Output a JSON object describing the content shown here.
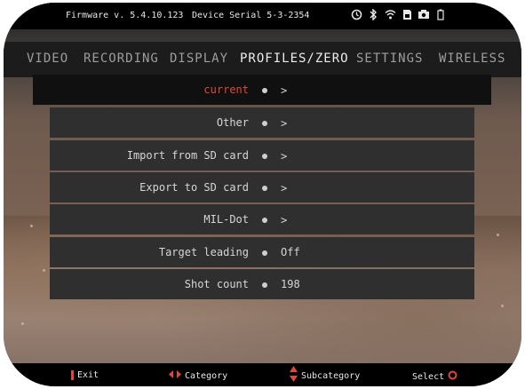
{
  "status": {
    "firmware": "Firmware v. 5.4.10.123",
    "serial": "Device Serial 5-3-2354",
    "icons": [
      "timer-icon",
      "bluetooth-icon",
      "wifi-icon",
      "sd-card-icon",
      "camera-icon",
      "battery-icon"
    ]
  },
  "tabs": [
    {
      "label": "VIDEO",
      "active": false
    },
    {
      "label": "RECORDING",
      "active": false
    },
    {
      "label": "DISPLAY",
      "active": false
    },
    {
      "label": "PROFILES/ZERO",
      "active": true
    },
    {
      "label": "SETTINGS",
      "active": false
    },
    {
      "label": "WIRELESS",
      "active": false
    }
  ],
  "menu": [
    {
      "label": "current",
      "value": "",
      "arrow": true,
      "selected": true
    },
    {
      "label": "Other",
      "value": "",
      "arrow": true,
      "selected": false
    },
    {
      "label": "Import from SD card",
      "value": "",
      "arrow": true,
      "selected": false
    },
    {
      "label": "Export to SD card",
      "value": "",
      "arrow": true,
      "selected": false
    },
    {
      "label": "MIL-Dot",
      "value": "",
      "arrow": true,
      "selected": false
    },
    {
      "label": "Target leading",
      "value": "Off",
      "arrow": false,
      "selected": false
    },
    {
      "label": "Shot count",
      "value": "198",
      "arrow": false,
      "selected": false
    }
  ],
  "chevron": ">",
  "bottom": {
    "exit": "Exit",
    "category": "Category",
    "subcategory": "Subcategory",
    "select": "Select"
  },
  "colors": {
    "accent_red": "#e0463c",
    "panel": "#2f2f2f",
    "selected_panel": "#101010"
  }
}
